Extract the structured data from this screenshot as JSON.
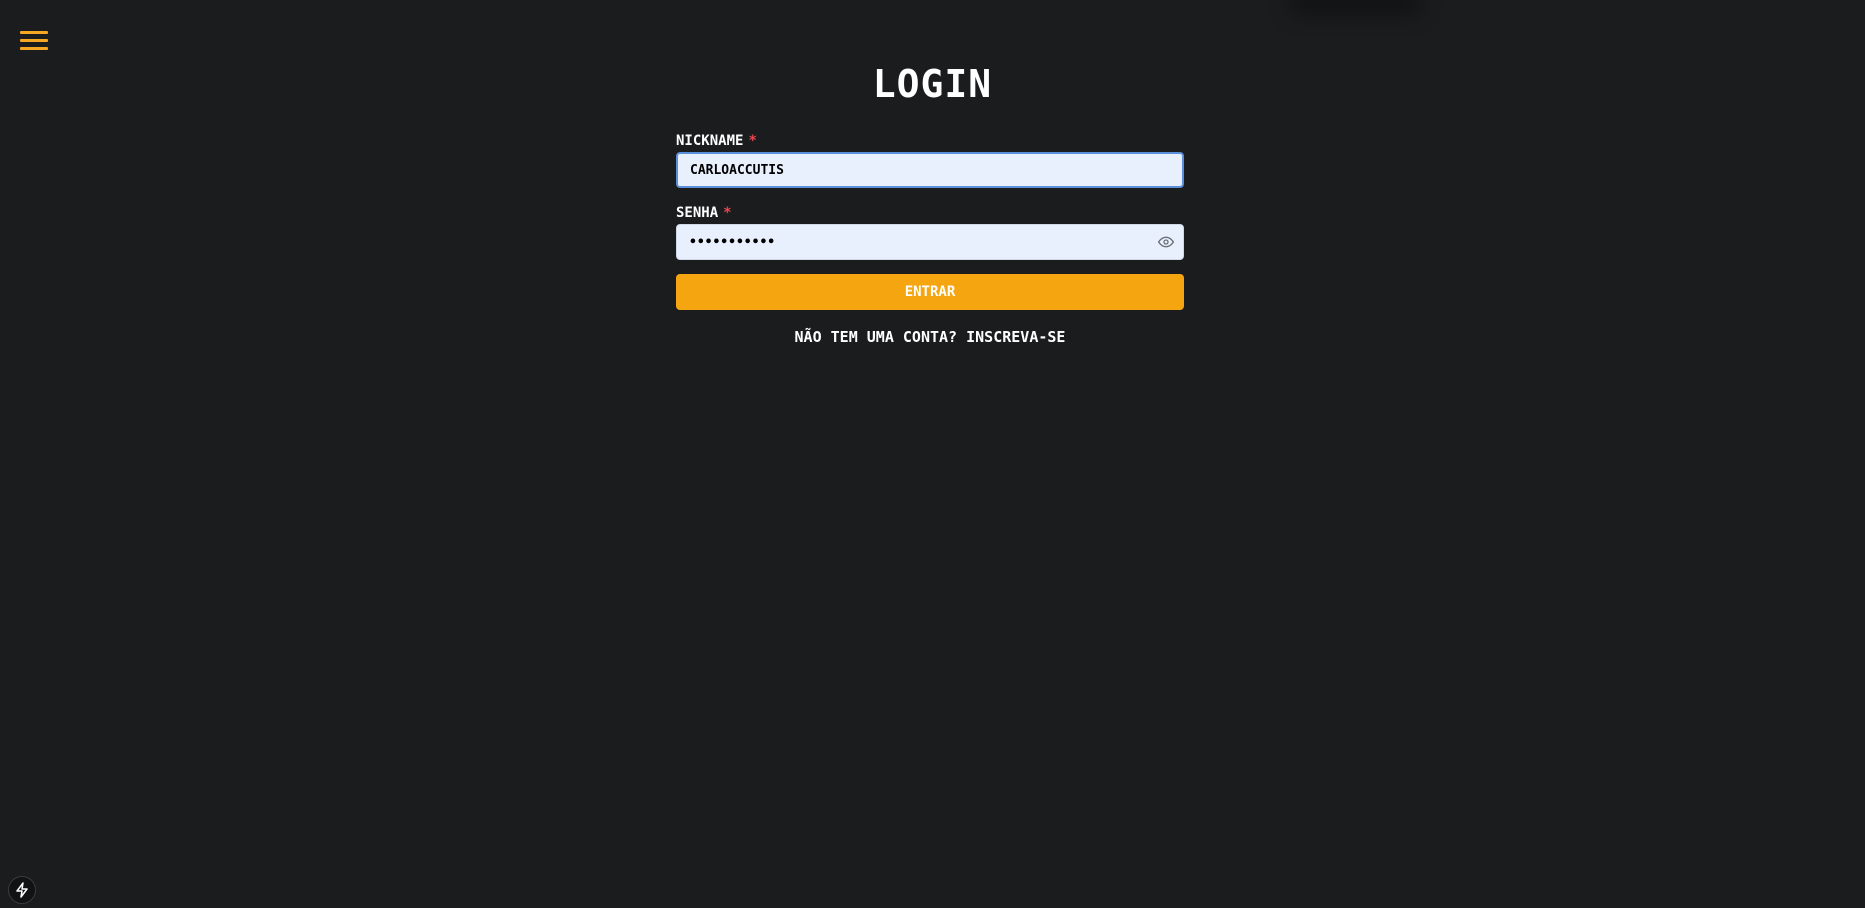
{
  "header": {
    "menu_icon": "hamburger-menu-icon",
    "accent_color": "#f5a623"
  },
  "login": {
    "title": "Login",
    "nickname_label": "Nickname",
    "nickname_required": "*",
    "nickname_value": "carloaccutis",
    "password_label": "Senha",
    "password_required": "*",
    "password_value": "carloaccut1",
    "password_toggle_icon": "eye-icon",
    "submit_label": "Entrar",
    "signup_text": "Não tem uma conta? Inscreva-se",
    "button_color": "#f5a50f",
    "required_color": "#e5484d"
  },
  "footer": {
    "dev_tools_icon": "lightning-bolt-icon"
  }
}
